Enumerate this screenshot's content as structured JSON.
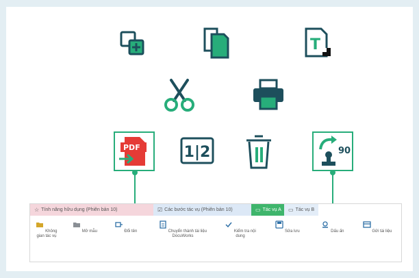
{
  "big_icons": {
    "copy_add": "copy-add-icon",
    "duplicate": "duplicate-page-icon",
    "text_format": "text-format-icon",
    "cut": "scissors-icon",
    "print": "printer-icon",
    "pdf_export": "pdf-export-icon",
    "page_split": "page-split-icon",
    "delete": "trash-icon",
    "rotate": "rotate-90-stamp-icon"
  },
  "icon_labels": {
    "pdf": "PDF",
    "split": "1|2",
    "rotate_deg": "90",
    "text_t": "T"
  },
  "colors": {
    "teal": "#27ad7a",
    "dark": "#1d4f5c",
    "red": "#e53b36",
    "panel": "#ffffff",
    "bg": "#e3eef3"
  },
  "ribbon": {
    "tabs": [
      {
        "label": "Tính năng hữu dụng (Phiên bản 10)",
        "icon": "star-icon"
      },
      {
        "label": "Các bước tác vụ (Phiên bản 10)",
        "icon": "checklist-icon"
      },
      {
        "label": "Tác vụ A",
        "icon": "doc-icon"
      },
      {
        "label": "Tác vụ B",
        "icon": "doc-icon"
      }
    ],
    "tools": [
      {
        "label": "Không gian tác vụ",
        "icon": "folder-icon"
      },
      {
        "label": "Mở mẫu",
        "icon": "template-icon"
      },
      {
        "label": "Đổi tên",
        "icon": "rename-icon"
      },
      {
        "label": "Chuyển thành tài liệu DocuWorks",
        "icon": "convert-icon"
      },
      {
        "label": "Kiểm tra nội dung",
        "icon": "check-icon"
      },
      {
        "label": "Sửa lưu",
        "icon": "save-icon"
      },
      {
        "label": "Dấu ấn",
        "icon": "stamp-icon"
      },
      {
        "label": "Gửi tài liệu",
        "icon": "send-icon"
      }
    ]
  }
}
